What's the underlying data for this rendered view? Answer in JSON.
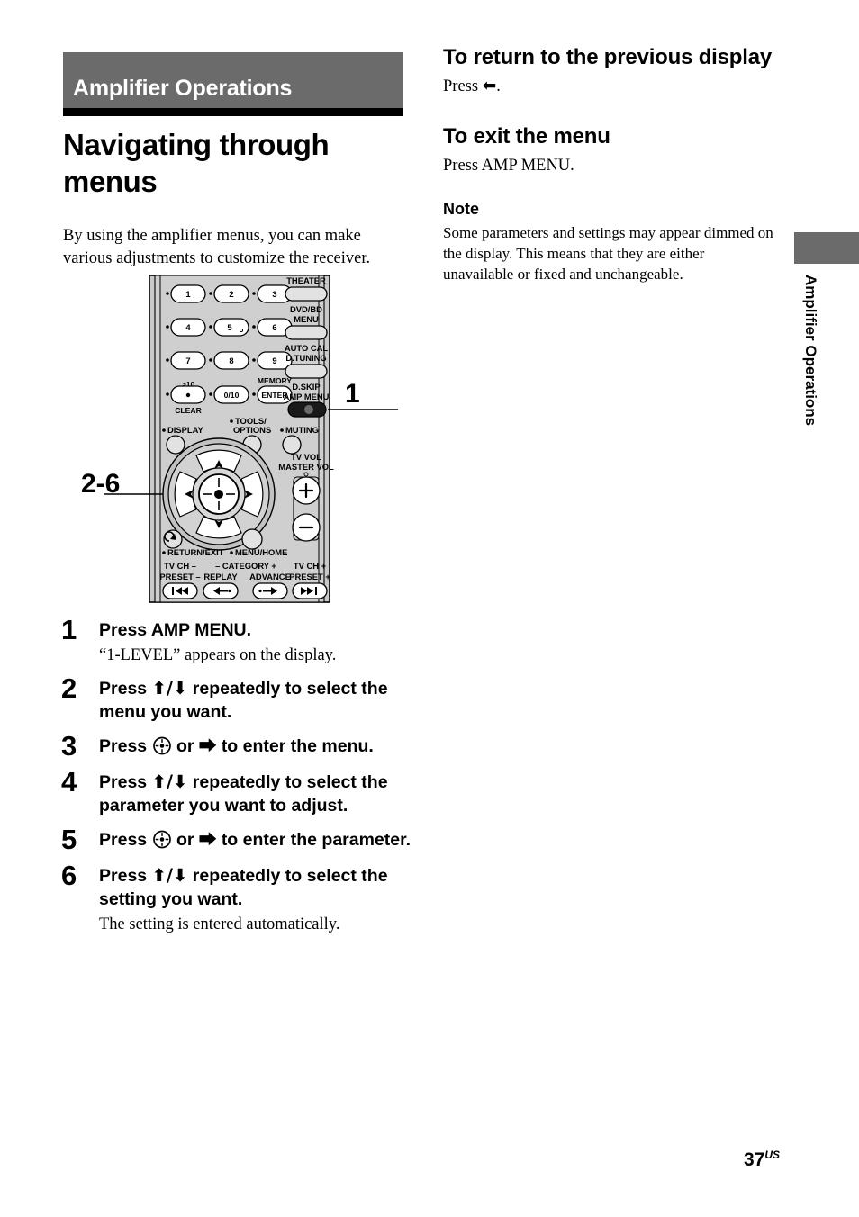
{
  "chapter": {
    "bar_title": "Amplifier Operations",
    "bar_color": "#6b6b6b"
  },
  "section": {
    "title": "Navigating through menus",
    "intro": "By using the amplifier menus, you can make various adjustments to customize the receiver."
  },
  "diagram": {
    "caption_alt": "Remote control handset illustration",
    "callouts": [
      {
        "label": "1",
        "points_to": "AMP MENU button"
      },
      {
        "label": "2-6",
        "points_to": "navigation cursor pad"
      }
    ],
    "remote_labels": {
      "number_keys": [
        "1",
        "2",
        "3",
        "4",
        "5",
        "6",
        "7",
        "8",
        "9"
      ],
      "key_gt10": ">10",
      "key_clear": "CLEAR",
      "key_010": "0/10",
      "key_memory": "MEMORY",
      "key_enter": "ENTER",
      "key_theater": "THEATER",
      "key_dvdbd": "DVD/BD",
      "key_menu": "MENU",
      "key_autocal": "AUTO CAL",
      "key_dtuning": "D.TUNING",
      "key_dskip": "D.SKIP",
      "key_ampmenu": "AMP MENU",
      "key_display": "DISPLAY",
      "key_tools": "TOOLS/",
      "key_options": "OPTIONS",
      "key_muting": "MUTING",
      "key_tvvol": "TV VOL",
      "key_mastervol": "MASTER VOL",
      "key_vol_plus": "+",
      "key_vol_minus": "−",
      "key_return": "RETURN/EXIT",
      "key_menuhome": "MENU/HOME",
      "key_tvch_minus": "TV CH –",
      "key_preset_minus": "PRESET –",
      "key_category_minus": "– CATEGORY +",
      "key_replay": "REPLAY",
      "key_advance": "ADVANCE",
      "key_tvch_plus": "TV CH +",
      "key_preset_plus": "PRESET +"
    }
  },
  "steps": [
    {
      "num": "1",
      "head_pre": "Press AMP MENU.",
      "head_mid": "",
      "head_post": "",
      "sub": "“1-LEVEL” appears on the display."
    },
    {
      "num": "2",
      "head_pre": "Press ",
      "head_glyph": "⬆/⬇",
      "head_post": " repeatedly to select the menu you want.",
      "sub": ""
    },
    {
      "num": "3",
      "head_pre": "Press ",
      "head_glyph": "enter-icon",
      "head_post": " or ⮕ to enter the menu.",
      "sub": ""
    },
    {
      "num": "4",
      "head_pre": "Press ",
      "head_glyph": "⬆/⬇",
      "head_post": " repeatedly to select the parameter you want to adjust.",
      "sub": ""
    },
    {
      "num": "5",
      "head_pre": "Press ",
      "head_glyph": "enter-icon",
      "head_post": " or ⮕ to enter the parameter.",
      "sub": ""
    },
    {
      "num": "6",
      "head_pre": "Press ",
      "head_glyph": "⬆/⬇",
      "head_post": " repeatedly to select the setting you want.",
      "sub": "The setting is entered automatically."
    }
  ],
  "right_column": {
    "h1_return": "To return to the previous display",
    "p_return_pre": "Press ",
    "p_return_post": ".",
    "h1_exit": "To exit the menu",
    "p_exit": "Press AMP MENU.",
    "note_head": "Note",
    "note_body": "Some parameters and settings may appear dimmed on the display. This means that they are either unavailable or fixed and unchangeable."
  },
  "side_tab": {
    "label": "Amplifier Operations"
  },
  "footer": {
    "page_number": "37",
    "page_suffix": "US"
  }
}
